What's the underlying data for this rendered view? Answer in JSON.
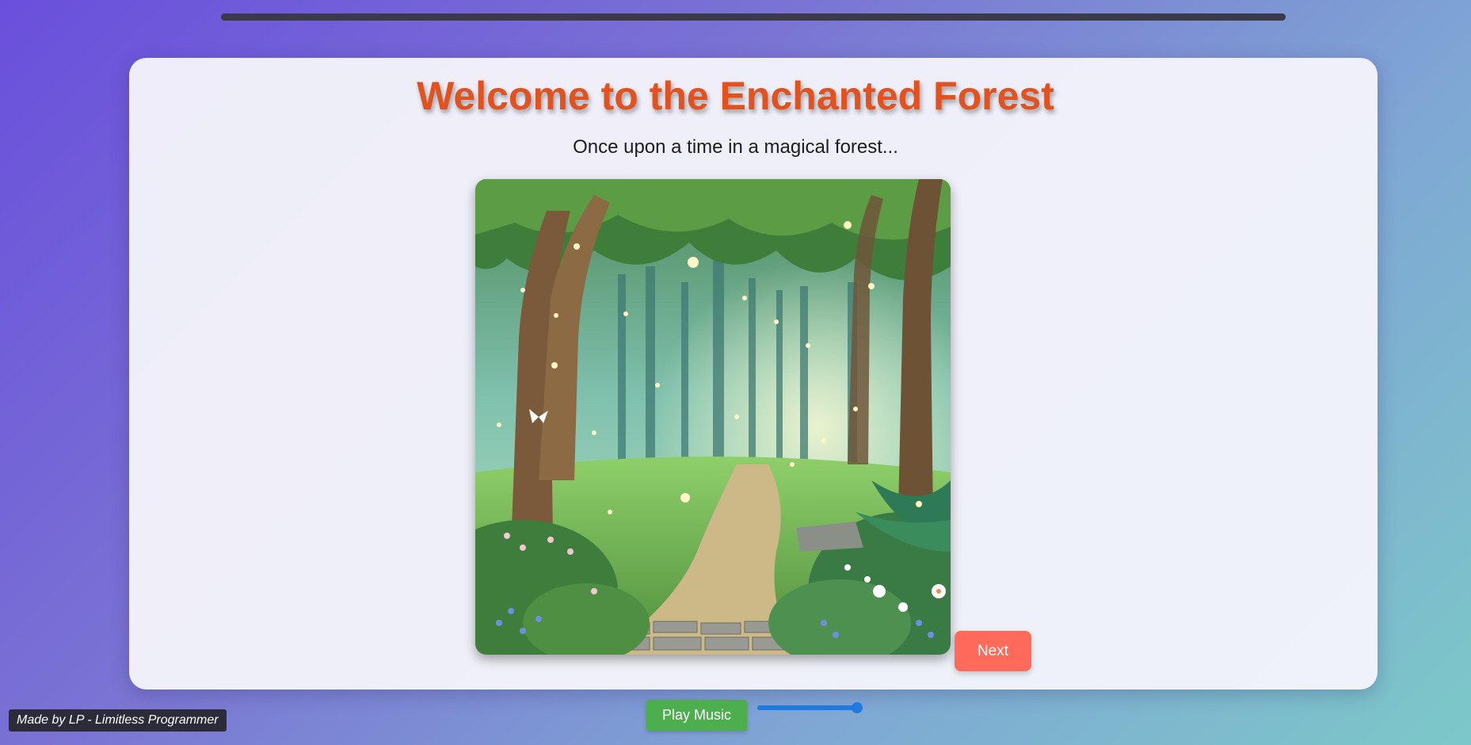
{
  "progress": {
    "value": 1.0
  },
  "story": {
    "title": "Welcome to the Enchanted Forest",
    "text": "Once upon a time in a magical forest..."
  },
  "controls": {
    "next_label": "Next",
    "music_label": "Play Music",
    "volume": 1.0
  },
  "footer": {
    "credit": "Made by LP - Limitless Programmer"
  },
  "colors": {
    "title": "#e2521f",
    "next_button": "#ff6a5a",
    "music_button": "#4cae4c",
    "slider": "#1f7ae0"
  }
}
